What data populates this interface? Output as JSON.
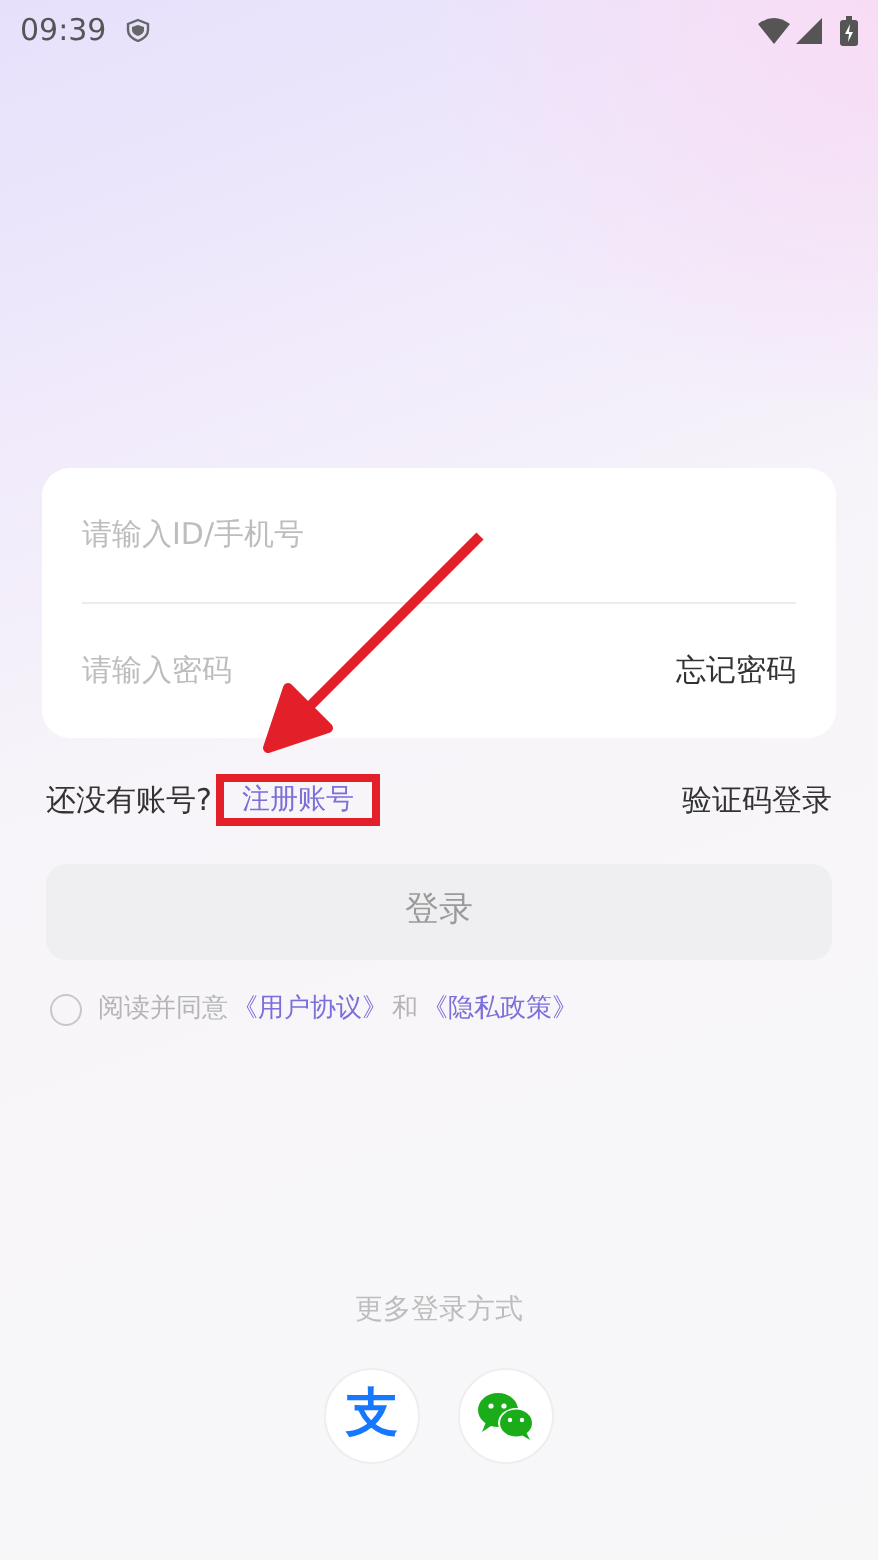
{
  "status_bar": {
    "time": "09:39"
  },
  "form": {
    "fields": [
      {
        "placeholder": "请输入ID/手机号"
      },
      {
        "placeholder": "请输入密码",
        "action": "忘记密码"
      }
    ]
  },
  "register": {
    "prompt": "还没有账号?",
    "link": "注册账号",
    "highlighted": true
  },
  "code_login": "验证码登录",
  "login_button": {
    "label": "登录",
    "disabled": true
  },
  "agreement": {
    "checked": false,
    "parts": [
      {
        "text": "阅读并同意",
        "kind": "plain"
      },
      {
        "text": "《用户协议》",
        "kind": "link"
      },
      {
        "text": "和",
        "kind": "plain"
      },
      {
        "text": "《隐私政策》",
        "kind": "link"
      }
    ]
  },
  "more_login": {
    "title": "更多登录方式",
    "options": [
      {
        "kind": "alipay",
        "glyph": "支"
      },
      {
        "kind": "wechat"
      }
    ]
  }
}
